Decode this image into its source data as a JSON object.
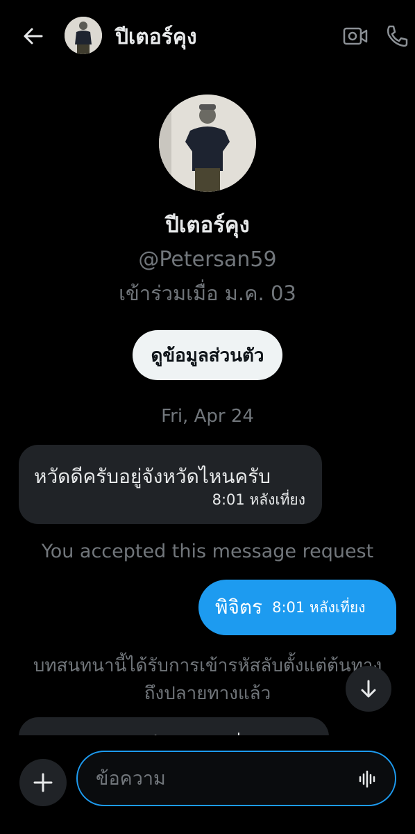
{
  "header": {
    "contact_name": "ปีเตอร์คุง"
  },
  "profile": {
    "name": "ปีเตอร์คุง",
    "handle": "@Petersan59",
    "joined": "เข้าร่วมเมื่อ ม.ค. 03",
    "view_profile_label": "ดูข้อมูลส่วนตัว"
  },
  "conversation": {
    "date_separator": "Fri, Apr 24",
    "messages": [
      {
        "direction": "incoming",
        "text": "หวัดดีครับอยู่จังหวัดไหนครับ",
        "time": "8:01 หลังเที่ยง"
      },
      {
        "direction": "outgoing",
        "text": "พิจิตร",
        "time": "8:01 หลังเที่ยง"
      }
    ],
    "system_accepted": "You accepted this message request",
    "system_encrypted_line1": "บทสนทนานี้ได้รับการเข้ารหัสลับตั้งแต่ต้นทาง",
    "system_encrypted_line2": "ถึงปลายทางแล้ว",
    "partial_message_text": "ผมอยู่จังหวัดไหนครับ นั่นเอง"
  },
  "composer": {
    "placeholder": "ข้อความ"
  },
  "colors": {
    "background": "#000000",
    "accent": "#1d9bf0",
    "bubble_incoming": "#202327",
    "muted_text": "#71767b"
  },
  "icons": [
    "back-arrow-icon",
    "video-camera-icon",
    "phone-icon",
    "arrow-down-icon",
    "plus-icon",
    "voice-waveform-icon"
  ]
}
